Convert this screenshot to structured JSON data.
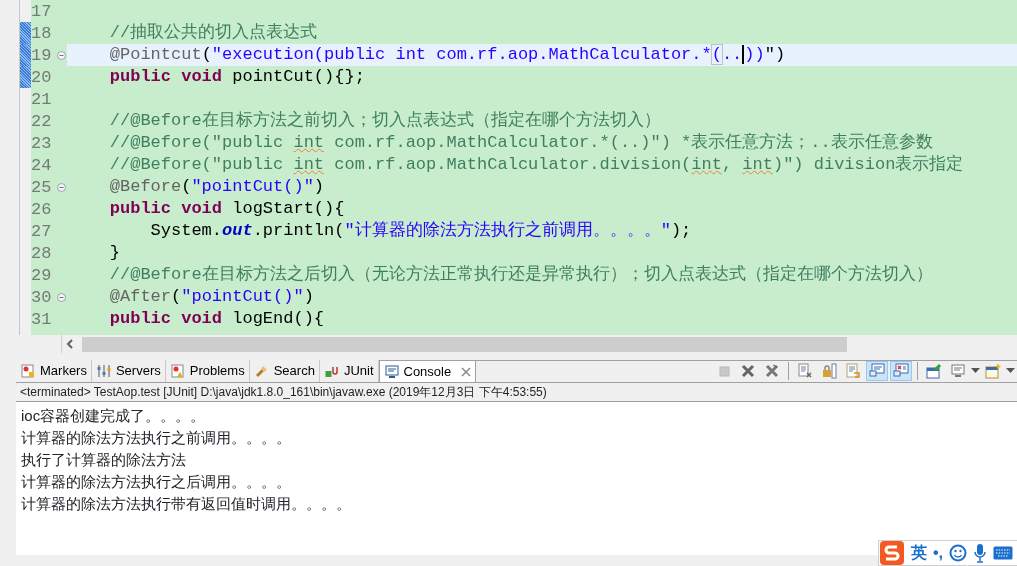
{
  "editor": {
    "lines": [
      {
        "number": "17",
        "fold": false,
        "current": false,
        "changed": false
      },
      {
        "number": "18",
        "fold": false,
        "current": false,
        "changed": true,
        "tokens": [
          {
            "kind": "comment",
            "text": "    //抽取公共的切入点表达式"
          }
        ]
      },
      {
        "number": "19",
        "fold": true,
        "current": true,
        "changed": true,
        "tokens": [
          {
            "kind": "annotation",
            "text": "    @Pointcut"
          },
          {
            "kind": "plain",
            "text": "("
          },
          {
            "kind": "string",
            "text": "\"execution(public int com.rf.aop.MathCalculator.*"
          },
          {
            "kind": "string",
            "text": "(",
            "boxed": true
          },
          {
            "kind": "string",
            "text": "..",
            "caret": true
          },
          {
            "kind": "string",
            "text": "))"
          },
          {
            "kind": "plain",
            "text": "\")"
          }
        ]
      },
      {
        "number": "20",
        "fold": false,
        "current": false,
        "changed": true,
        "tokens": [
          {
            "kind": "keyword",
            "text": "    public void"
          },
          {
            "kind": "plain",
            "text": " pointCut(){};"
          }
        ]
      },
      {
        "number": "21",
        "fold": false,
        "current": false,
        "changed": false
      },
      {
        "number": "22",
        "fold": false,
        "current": false,
        "changed": false,
        "tokens": [
          {
            "kind": "comment",
            "text": "    //@Before在目标方法之前切入；切入点表达式（指定在哪个方法切入）"
          }
        ]
      },
      {
        "number": "23",
        "fold": false,
        "current": false,
        "changed": false,
        "tokens": [
          {
            "kind": "comment",
            "text": "    //@Before(\"public "
          },
          {
            "kind": "comment",
            "text": "int",
            "misspelled": true
          },
          {
            "kind": "comment",
            "text": " com.rf.aop.MathCalculator.*(..)\") *表示任意方法；..表示任意参数"
          }
        ]
      },
      {
        "number": "24",
        "fold": false,
        "current": false,
        "changed": false,
        "tokens": [
          {
            "kind": "comment",
            "text": "    //@Before(\"public "
          },
          {
            "kind": "comment",
            "text": "int",
            "misspelled": true
          },
          {
            "kind": "comment",
            "text": " com.rf.aop.MathCalculator.division("
          },
          {
            "kind": "comment",
            "text": "int",
            "misspelled": true
          },
          {
            "kind": "comment",
            "text": ", "
          },
          {
            "kind": "comment",
            "text": "int",
            "misspelled": true
          },
          {
            "kind": "comment",
            "text": ")\") division表示指定"
          }
        ]
      },
      {
        "number": "25",
        "fold": true,
        "current": false,
        "changed": false,
        "tokens": [
          {
            "kind": "annotation",
            "text": "    @Before"
          },
          {
            "kind": "plain",
            "text": "("
          },
          {
            "kind": "string",
            "text": "\"pointCut()\""
          },
          {
            "kind": "plain",
            "text": ")"
          }
        ]
      },
      {
        "number": "26",
        "fold": false,
        "current": false,
        "changed": false,
        "tokens": [
          {
            "kind": "keyword",
            "text": "    public void"
          },
          {
            "kind": "plain",
            "text": " logStart(){"
          }
        ]
      },
      {
        "number": "27",
        "fold": false,
        "current": false,
        "changed": false,
        "tokens": [
          {
            "kind": "plain",
            "text": "        System."
          },
          {
            "kind": "field",
            "text": "out"
          },
          {
            "kind": "plain",
            "text": ".println("
          },
          {
            "kind": "string",
            "text": "\"计算器的除法方法执行之前调用。。。。\""
          },
          {
            "kind": "plain",
            "text": ");"
          }
        ]
      },
      {
        "number": "28",
        "fold": false,
        "current": false,
        "changed": false,
        "tokens": [
          {
            "kind": "plain",
            "text": "    }"
          }
        ]
      },
      {
        "number": "29",
        "fold": false,
        "current": false,
        "changed": false,
        "tokens": [
          {
            "kind": "comment",
            "text": "    //@Before在目标方法之后切入（无论方法正常执行还是异常执行）；切入点表达式（指定在哪个方法切入）"
          }
        ]
      },
      {
        "number": "30",
        "fold": true,
        "current": false,
        "changed": false,
        "tokens": [
          {
            "kind": "annotation",
            "text": "    @After"
          },
          {
            "kind": "plain",
            "text": "("
          },
          {
            "kind": "string",
            "text": "\"pointCut()\""
          },
          {
            "kind": "plain",
            "text": ")"
          }
        ]
      },
      {
        "number": "31",
        "fold": false,
        "current": false,
        "changed": false,
        "tokens": [
          {
            "kind": "keyword",
            "text": "    public void"
          },
          {
            "kind": "plain",
            "text": " logEnd(){"
          }
        ]
      }
    ]
  },
  "views": {
    "tabs": [
      {
        "label": "Markers",
        "kind": "markers",
        "selected": false
      },
      {
        "label": "Servers",
        "kind": "servers",
        "selected": false
      },
      {
        "label": "Problems",
        "kind": "problems",
        "selected": false
      },
      {
        "label": "Search",
        "kind": "search",
        "selected": false
      },
      {
        "label": "JUnit",
        "kind": "junit",
        "selected": false
      },
      {
        "label": "Console",
        "kind": "console",
        "selected": true
      }
    ],
    "toolbar": [
      {
        "kind": "terminate",
        "disabled": true,
        "pressed": false
      },
      {
        "kind": "remove",
        "disabled": false,
        "pressed": false
      },
      {
        "kind": "remove-all",
        "disabled": false,
        "pressed": false
      },
      {
        "kind": "separator"
      },
      {
        "kind": "clear",
        "disabled": false,
        "pressed": false
      },
      {
        "kind": "scroll-lock",
        "disabled": false,
        "pressed": false
      },
      {
        "kind": "word-wrap",
        "disabled": false,
        "pressed": false
      },
      {
        "kind": "show-out",
        "disabled": false,
        "pressed": true
      },
      {
        "kind": "show-err",
        "disabled": false,
        "pressed": true
      },
      {
        "kind": "separator"
      },
      {
        "kind": "pin",
        "disabled": false,
        "pressed": false
      },
      {
        "kind": "display",
        "disabled": false,
        "pressed": false
      },
      {
        "kind": "dropdown"
      },
      {
        "kind": "open",
        "disabled": false,
        "pressed": false
      },
      {
        "kind": "dropdown"
      }
    ]
  },
  "console": {
    "header": "<terminated> TestAop.test [JUnit] D:\\java\\jdk1.8.0_161\\bin\\javaw.exe (2019年12月3日 下午4:53:55)",
    "output": [
      "ioc容器创建完成了。。。。",
      "计算器的除法方法执行之前调用。。。。",
      "执行了计算器的除法方法",
      "计算器的除法方法执行之后调用。。。。",
      "计算器的除法方法执行带有返回值时调用。。。。"
    ]
  },
  "ime": {
    "mode": "英",
    "punctuation": "•,"
  }
}
